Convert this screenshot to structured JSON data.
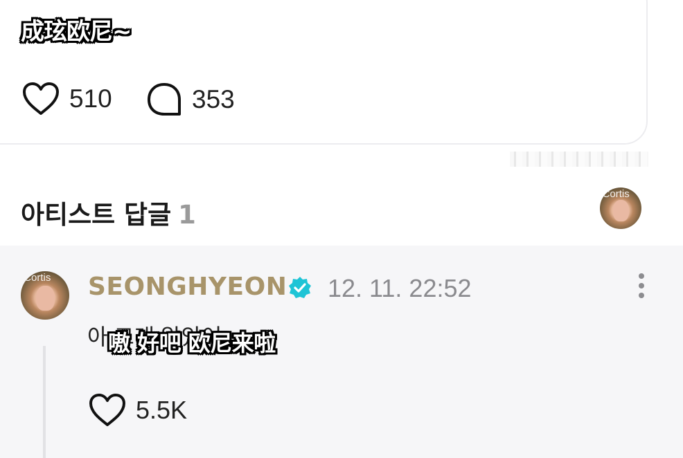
{
  "post": {
    "subtitle_overlay": "成玹欧尼~",
    "like_icon": "heart-outline-icon",
    "like_count": "510",
    "comment_icon": "chat-bubble-icon",
    "comment_count": "353"
  },
  "artist_replies": {
    "title": "아티스트 답글",
    "count": "1"
  },
  "reply": {
    "author": "SEONGHYEON",
    "verified_icon": "verified-badge-icon",
    "timestamp": "12. 11. 22:52",
    "text_partial": "아 그래 알았어",
    "subtitle_overlay": "嗷 好吧 欧尼来啦",
    "like_icon": "heart-outline-icon",
    "like_count": "5.5K",
    "more_icon": "vertical-dots-icon",
    "avatar_watermark": "Cortis"
  },
  "colors": {
    "author_gold": "#a8946a",
    "verified_cyan": "#1ec4d6",
    "panel_bg": "#f6f6f8",
    "muted_count": "#9a9a9a"
  }
}
